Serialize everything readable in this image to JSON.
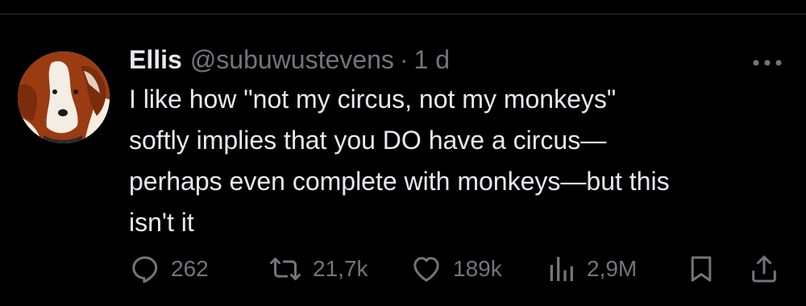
{
  "tweet": {
    "display_name": "Ellis",
    "handle": "@subuwustevens",
    "separator": "·",
    "time": "1 d",
    "text_lines": [
      "I like how \"not my circus, not my monkeys\"",
      "softly implies that you DO have a circus—",
      "perhaps even complete with monkeys—but this",
      "isn't it"
    ]
  },
  "actions": {
    "replies": "262",
    "reposts": "21,7k",
    "likes": "189k",
    "views": "2,9M"
  },
  "icons": {
    "more": "more-dots-icon",
    "reply": "reply-bubble-icon",
    "repost": "repost-icon",
    "like": "heart-icon",
    "views": "analytics-bars-icon",
    "bookmark": "bookmark-icon",
    "share": "share-upload-icon"
  },
  "colors": {
    "background": "#000000",
    "text": "#e7e9ea",
    "muted": "#71767b",
    "avatar_brown": "#9a3b12"
  }
}
